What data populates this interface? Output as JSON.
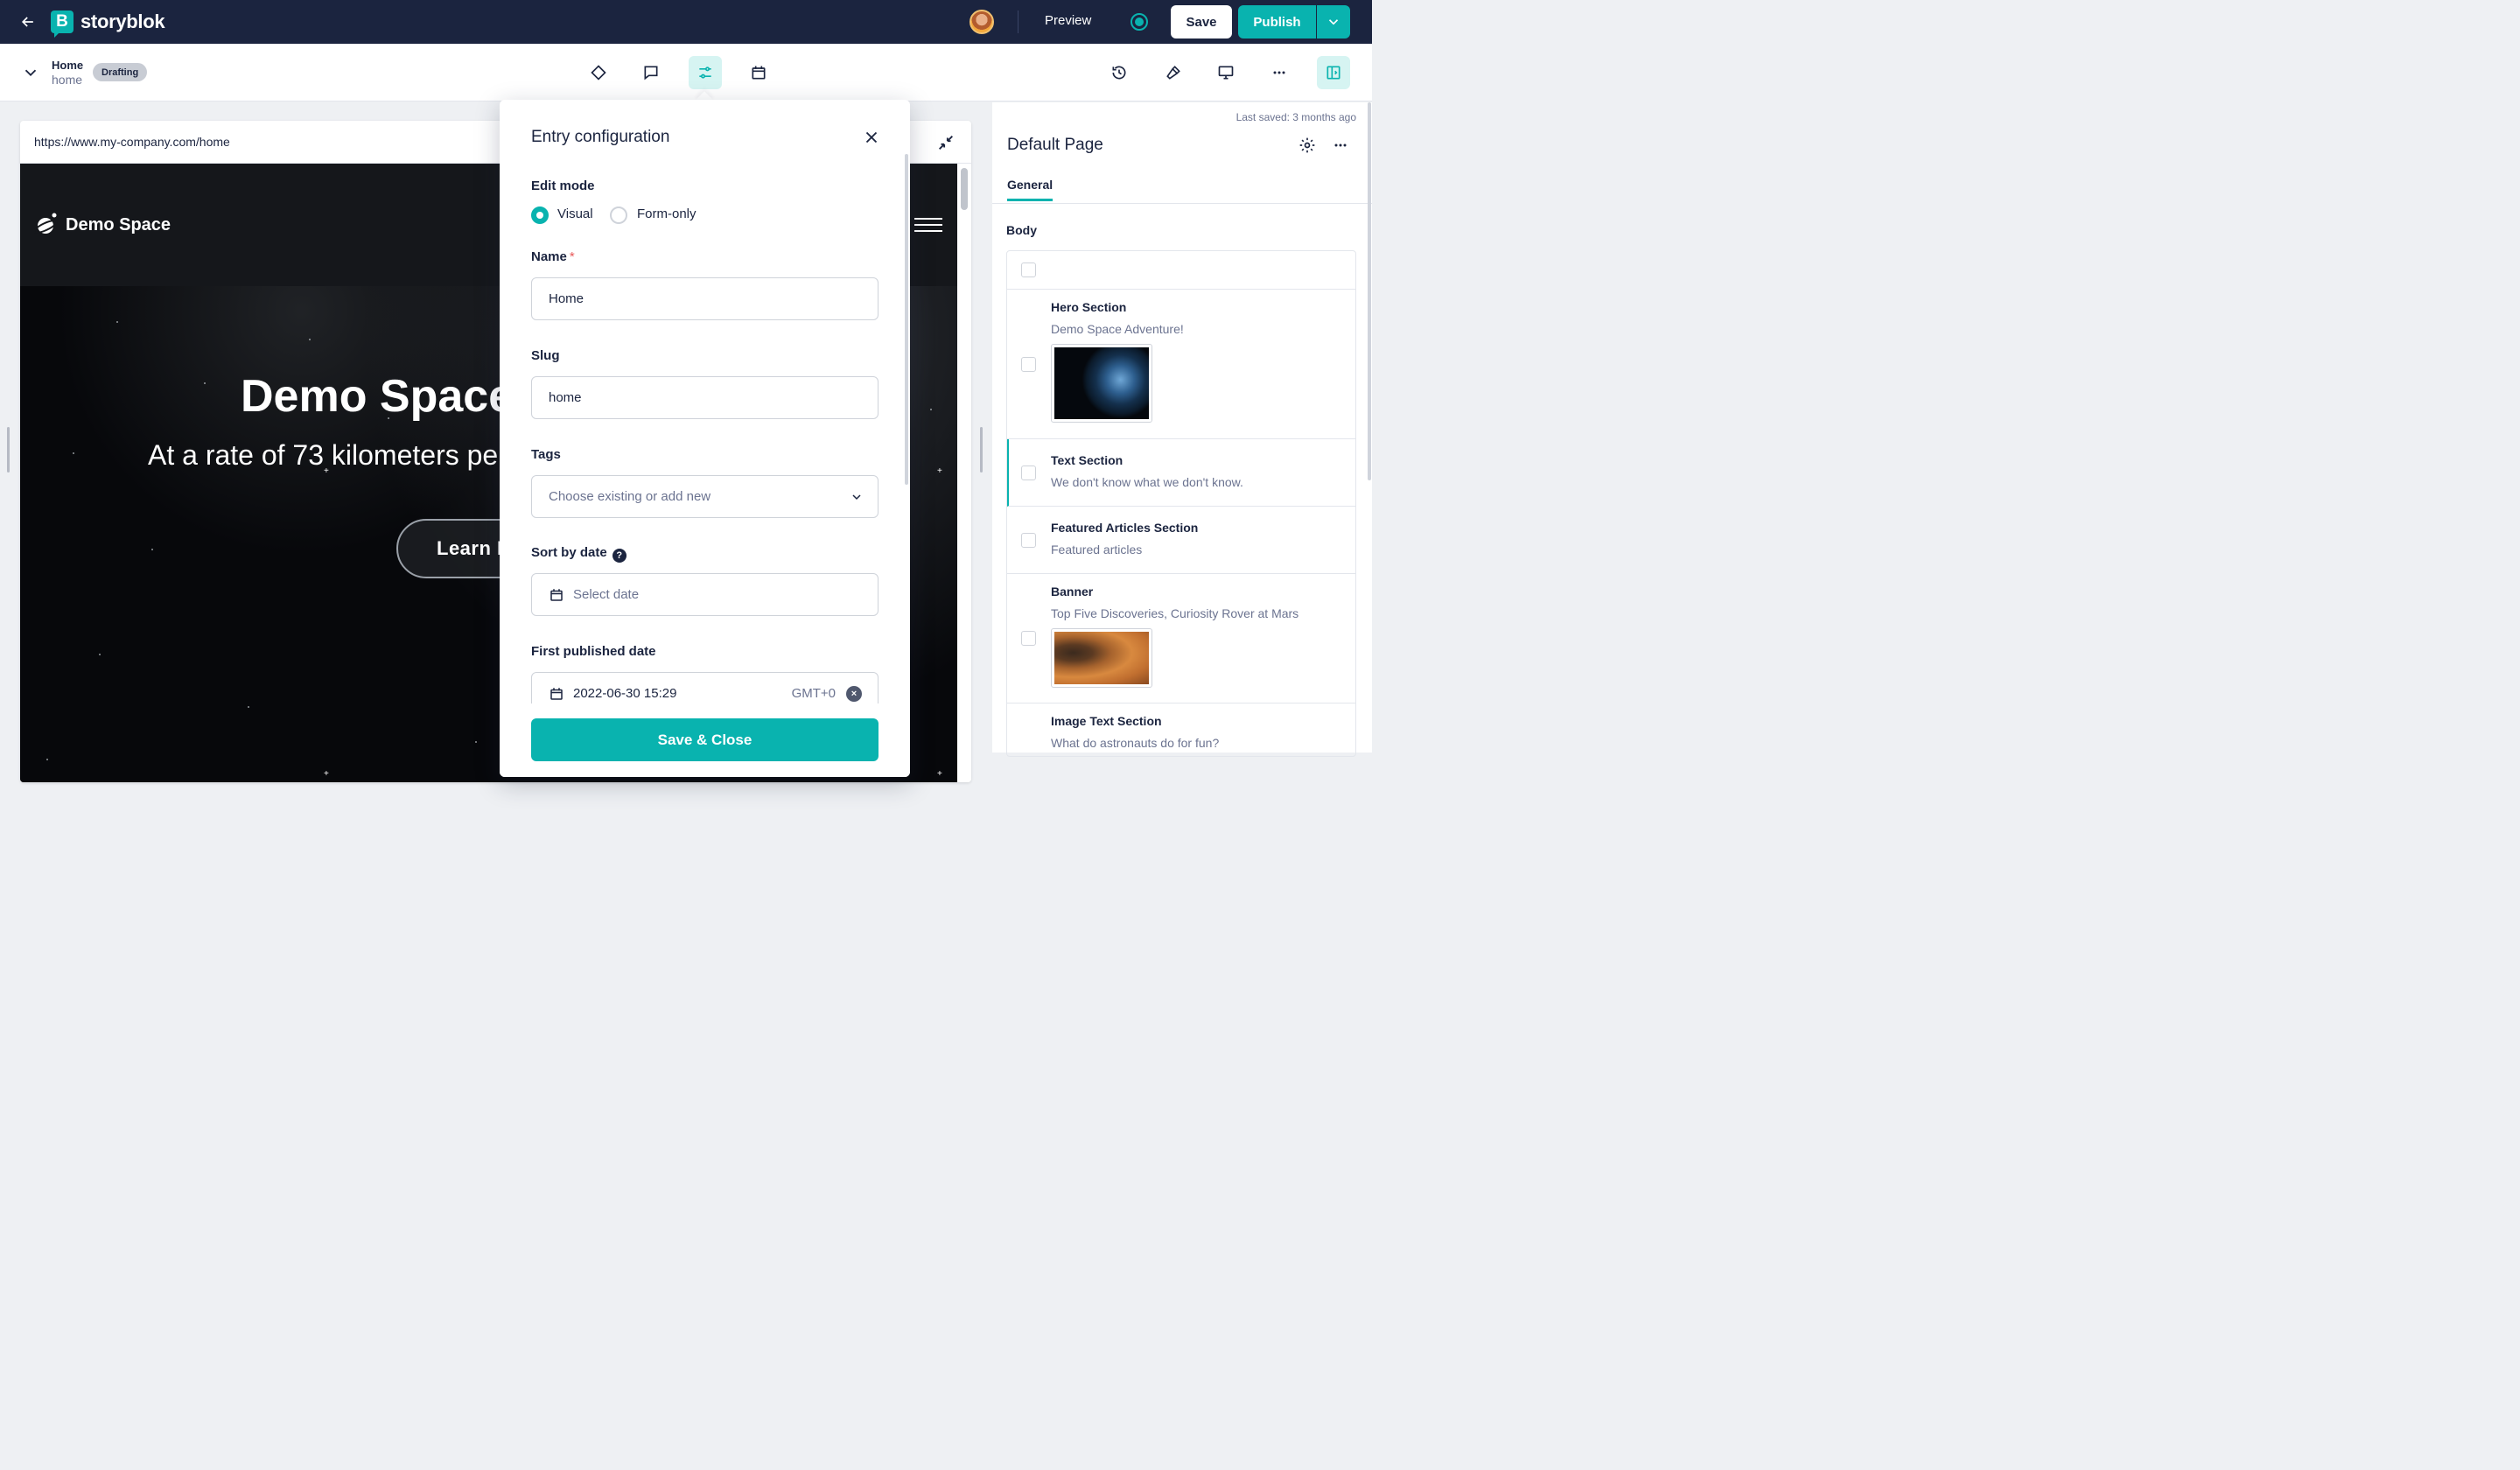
{
  "topbar": {
    "logo_letter": "B",
    "logo_text": "storyblok",
    "preview_label": "Preview",
    "save_label": "Save",
    "publish_label": "Publish"
  },
  "story": {
    "title": "Home",
    "slug": "home",
    "status": "Drafting"
  },
  "preview": {
    "url": "https://www.my-company.com/home",
    "site_name": "Demo Space",
    "hero_title": "Demo Space",
    "hero_subtitle": "At a rate of 73 kilometers pe",
    "cta_label": "Learn M"
  },
  "modal": {
    "title": "Entry configuration",
    "edit_mode_label": "Edit mode",
    "edit_mode_options": [
      "Visual",
      "Form-only"
    ],
    "edit_mode_selected": "Visual",
    "name_label": "Name",
    "name_required_mark": "*",
    "name_value": "Home",
    "slug_label": "Slug",
    "slug_value": "home",
    "tags_label": "Tags",
    "tags_placeholder": "Choose existing or add new",
    "sort_label": "Sort by date",
    "sort_help": "?",
    "sort_placeholder": "Select date",
    "first_published_label": "First published date",
    "first_published_value": "2022-06-30 15:29",
    "timezone": "GMT+0",
    "clear_glyph": "×",
    "save_close_label": "Save & Close"
  },
  "panel": {
    "last_saved": "Last saved: 3 months ago",
    "title": "Default Page",
    "tab": "General",
    "body_label": "Body",
    "blocks": [
      {
        "name": "Hero Section",
        "desc": "Demo Space Adventure!"
      },
      {
        "name": "Text Section",
        "desc": "We don't know what we don't know."
      },
      {
        "name": "Featured Articles Section",
        "desc": "Featured articles"
      },
      {
        "name": "Banner",
        "desc": "Top Five Discoveries, Curiosity Rover at Mars"
      },
      {
        "name": "Image Text Section",
        "desc": "What do astronauts do for fun?"
      }
    ]
  },
  "colors": {
    "accent": "#09b3af",
    "navy": "#1b243f",
    "muted": "#6b7390"
  }
}
